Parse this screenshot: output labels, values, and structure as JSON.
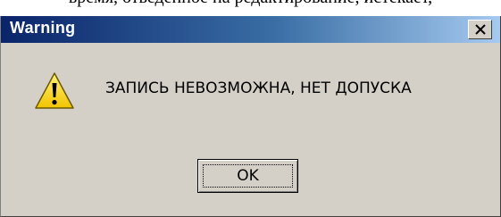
{
  "background_document": {
    "text": "время, отведенное на редактирование, истекает,"
  },
  "dialog": {
    "title": "Warning",
    "message": "ЗАПИСЬ НЕВОЗМОЖНА, НЕТ ДОПУСКА",
    "icon": "warning-icon",
    "ok_label": "OK",
    "close_icon": "close-icon"
  },
  "colors": {
    "title_bar_start": "#0a246a",
    "title_bar_end": "#a6caf0",
    "dialog_face": "#d4d0c8",
    "warning_yellow": "#ffe400"
  }
}
